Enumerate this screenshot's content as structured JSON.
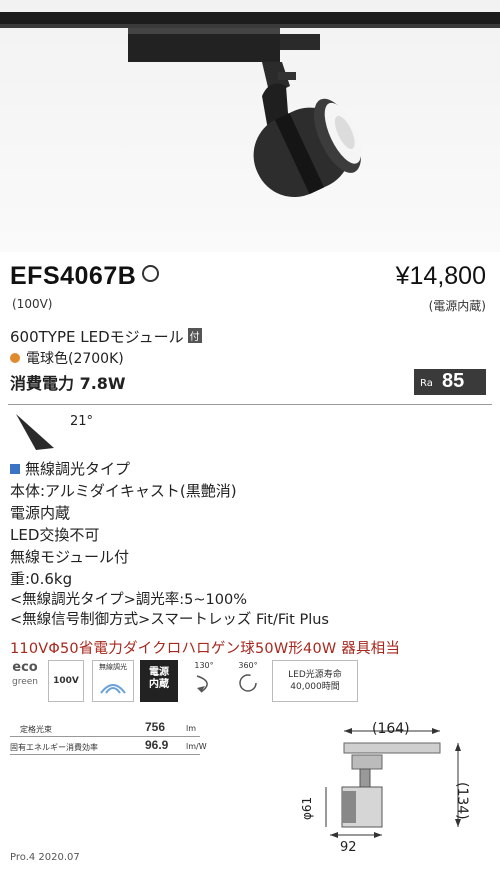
{
  "product": {
    "model": "EFS4067B",
    "price": "¥14,800",
    "voltage": "(100V)",
    "power_unit_note": "(電源内蔵)",
    "type_line": "600TYPE LEDモジュール",
    "type_tag": "付",
    "color_temp": "電球色(2700K)",
    "consumption": "消費電力 7.8W",
    "ra_label": "Ra",
    "ra_value": "85",
    "beam_angle": "21°"
  },
  "features": {
    "heading": "無線調光タイプ",
    "lines": [
      "本体:アルミダイキャスト(黒艶消)",
      "電源内蔵",
      "LED交換不可",
      "無線モジュール付",
      "重:0.6kg"
    ],
    "blue_lines": [
      "<無線調光タイプ>調光率:5~100%",
      "<無線信号制御方式>スマートレッズ Fit/Fit Plus"
    ],
    "equivalent": "110VΦ50省電力ダイクロハロゲン球50W形40W 器具相当"
  },
  "icons": {
    "eco_top": "eco",
    "eco_bottom": "green",
    "volt": "100V",
    "wireless": "無線調光",
    "power_box_1": "電源",
    "power_box_2": "内蔵",
    "tilt": "130°",
    "rotate": "360°",
    "life_1": "LED光源寿命",
    "life_2": "40,000時間"
  },
  "efficiency": {
    "flux_label": "定格光束",
    "flux_value": "756",
    "flux_unit": "lm",
    "eff_label": "固有エネルギー消費効率",
    "eff_value": "96.9",
    "eff_unit": "lm/W"
  },
  "dimensions": {
    "length": "(164)",
    "height": "(134)",
    "diameter": "φ61",
    "depth": "92"
  },
  "footer": "Pro.4 2020.07",
  "colors": {
    "blue": "#3b74c4",
    "red": "#a8281e",
    "orange": "#e08a2e"
  }
}
